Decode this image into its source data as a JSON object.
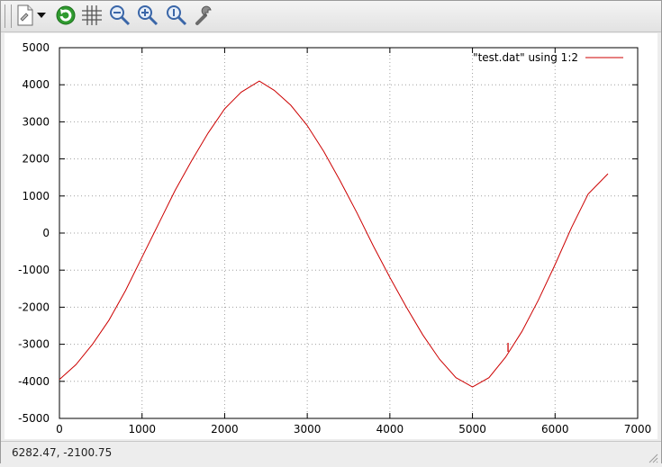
{
  "toolbar": {
    "icons": [
      "export-icon",
      "dropdown-arrow-icon",
      "replot-icon",
      "grid-icon",
      "unzoom-icon",
      "zoom-in-icon",
      "zoom-reset-icon",
      "config-icon"
    ]
  },
  "status": {
    "coordinates": "6282.47, -2100.75"
  },
  "colors": {
    "series": "#cc0000",
    "grid": "#a0a0a0"
  },
  "chart_data": {
    "type": "line",
    "title": "",
    "xlabel": "",
    "ylabel": "",
    "xlim": [
      0,
      7000
    ],
    "ylim": [
      -5000,
      5000
    ],
    "x_ticks": [
      0,
      1000,
      2000,
      3000,
      4000,
      5000,
      6000,
      7000
    ],
    "y_ticks": [
      -5000,
      -4000,
      -3000,
      -2000,
      -1000,
      0,
      1000,
      2000,
      3000,
      4000,
      5000
    ],
    "grid": true,
    "legend_position": "top-right",
    "series": [
      {
        "name": "\"test.dat\" using 1:2",
        "x": [
          0,
          200,
          400,
          600,
          800,
          1000,
          1200,
          1400,
          1600,
          1800,
          2000,
          2200,
          2420,
          2600,
          2800,
          3000,
          3200,
          3400,
          3600,
          3800,
          4000,
          4200,
          4400,
          4600,
          4800,
          5000,
          5200,
          5400,
          5600,
          5800,
          6000,
          6200,
          6400,
          6640
        ],
        "y": [
          -3950,
          -3550,
          -3000,
          -2350,
          -1550,
          -650,
          250,
          1150,
          1950,
          2700,
          3350,
          3800,
          4100,
          3850,
          3450,
          2900,
          2200,
          1400,
          550,
          -350,
          -1200,
          -2000,
          -2750,
          -3400,
          -3900,
          -4150,
          -3900,
          -3350,
          -2650,
          -1800,
          -850,
          150,
          1050,
          1600
        ]
      }
    ],
    "annotations": [
      {
        "text": "I",
        "x": 5430,
        "y": -3200
      }
    ]
  }
}
